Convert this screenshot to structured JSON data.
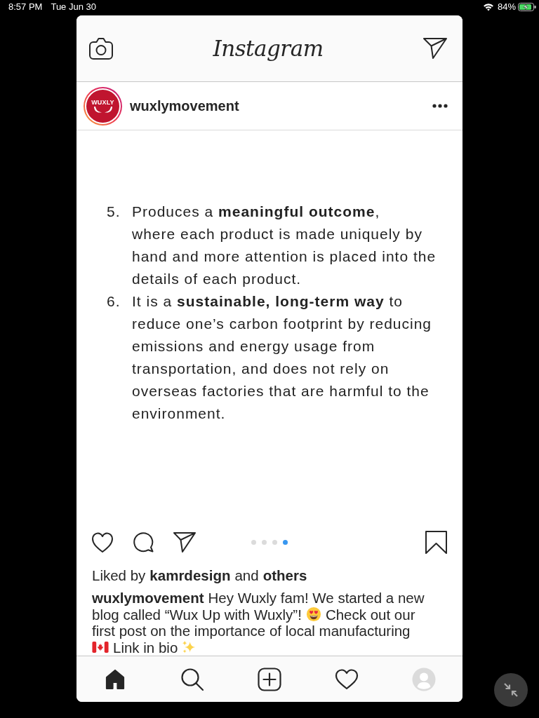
{
  "status_bar": {
    "time": "8:57 PM",
    "date": "Tue Jun 30",
    "battery": "84%"
  },
  "header": {
    "title": "Instagram"
  },
  "post": {
    "username": "wuxlymovement",
    "avatar_text": "WUXLY",
    "image": {
      "list": [
        {
          "number": "5.",
          "text": "Produces a **meaningful outcome**,\nwhere each product is made uniquely by\nhand and more attention is placed into the\ndetails of each product."
        },
        {
          "number": "6.",
          "text": "It is a **sustainable, long-term way** to\nreduce one’s carbon footprint by reducing\nemissions and energy usage from\ntransportation, and does not rely on\noverseas factories that are harmful to the\nenvironment."
        }
      ]
    },
    "carousel_dots": [
      {
        "selected": false
      },
      {
        "selected": false
      },
      {
        "selected": false
      },
      {
        "selected": true
      }
    ],
    "likes": [
      {
        "kind": "text",
        "text": "Liked by"
      },
      {
        "kind": "link",
        "text": "kamrdesign"
      },
      {
        "kind": "text",
        "text": "and"
      },
      {
        "kind": "link",
        "text": "others"
      }
    ],
    "caption": {
      "lines": [
        {
          "parts": [
            {
              "kind": "username",
              "text": "wuxlymovement"
            },
            {
              "kind": "text",
              "text": "Hey Wuxly fam! We started a new"
            }
          ]
        },
        {
          "parts": [
            {
              "kind": "text",
              "text": "blog called “Wux Up with Wuxly”!"
            },
            {
              "kind": "smiley"
            },
            {
              "kind": "text",
              "text": "Check out our"
            }
          ]
        },
        {
          "parts": [
            {
              "kind": "text",
              "text": "first post on the importance of local manufacturing"
            }
          ]
        },
        {
          "parts": [
            {
              "kind": "flag"
            },
            {
              "kind": "text",
              "text": "Link in bio"
            },
            {
              "kind": "sparkles"
            }
          ]
        }
      ]
    }
  },
  "bottom_nav": [
    {
      "kind": "home",
      "selected": true
    },
    {
      "kind": "search",
      "selected": false
    },
    {
      "kind": "add",
      "selected": false
    },
    {
      "kind": "activity",
      "selected": false
    },
    {
      "kind": "profile",
      "selected": false
    }
  ]
}
